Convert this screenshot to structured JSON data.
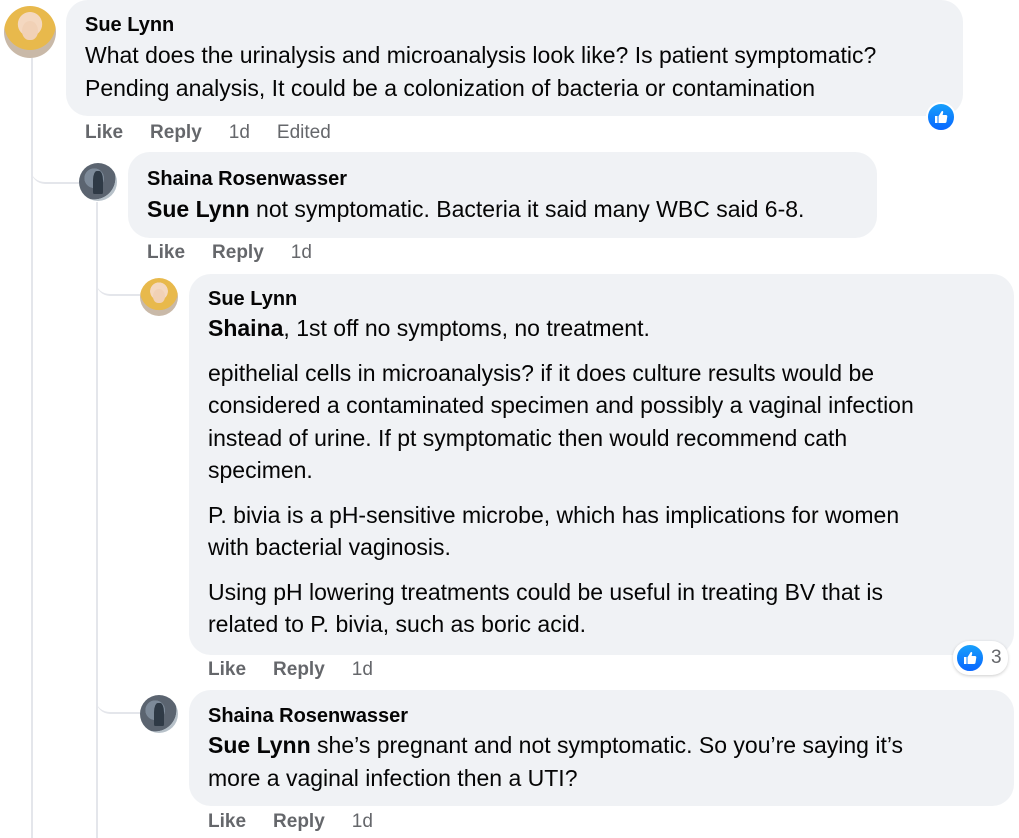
{
  "actions": {
    "like": "Like",
    "reply": "Reply"
  },
  "comments": [
    {
      "author": "Sue Lynn",
      "lines": [
        "What does the urinalysis and microanalysis look like? Is patient symptomatic?",
        "Pending analysis, It could be a colonization of bacteria or contamination"
      ],
      "time": "1d",
      "edited": "Edited",
      "reaction": {
        "icon": "like-icon"
      }
    },
    {
      "author": "Shaina Rosenwasser",
      "mention": "Sue Lynn",
      "text": " not symptomatic. Bacteria it said many WBC said 6-8.",
      "time": "1d"
    },
    {
      "author": "Sue Lynn",
      "mention": "Shaina",
      "first_text": ", 1st off no symptoms, no treatment.",
      "paragraphs": [
        [
          "epithelial cells in microanalysis? if it does culture results would be",
          "considered a contaminated specimen and possibly a vaginal infection",
          "instead of urine. If pt symptomatic then would recommend cath",
          "specimen."
        ],
        [
          "P. bivia is a pH-sensitive microbe, which has implications for women",
          "with bacterial vaginosis."
        ],
        [
          "Using pH lowering treatments could be useful in treating BV that is",
          "related to P. bivia, such as boric acid."
        ]
      ],
      "time": "1d",
      "reaction": {
        "icon": "like-icon",
        "count": "3"
      }
    },
    {
      "author": "Shaina Rosenwasser",
      "mention": "Sue Lynn",
      "text_line1": " she’s pregnant and not symptomatic. So you’re saying it’s",
      "text_line2": "more a vaginal infection then a UTI?",
      "time": "1d"
    }
  ],
  "colors": {
    "bubble": "#f0f2f5",
    "meta": "#65676b",
    "like_blue": "#0866ff",
    "thread_line": "#e4e6eb"
  }
}
